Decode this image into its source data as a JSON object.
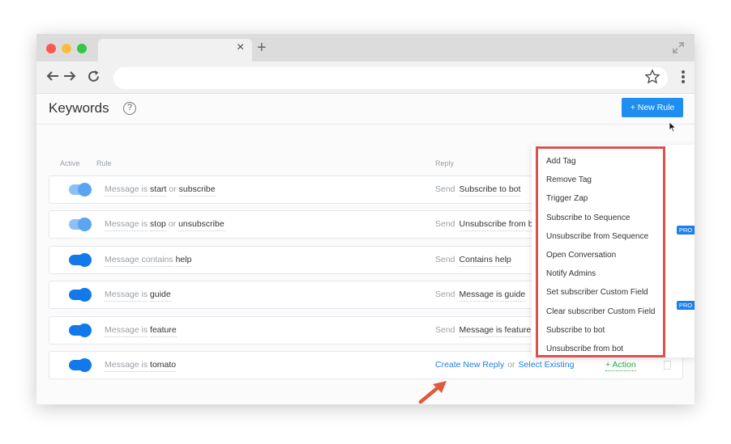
{
  "browser": {
    "tab_close": "×",
    "new_tab": "+"
  },
  "page": {
    "title": "Keywords",
    "help": "?",
    "new_rule_label": "+ New Rule"
  },
  "columns": {
    "active": "Active",
    "rule": "Rule",
    "reply": "Reply"
  },
  "rows": [
    {
      "active": true,
      "toggle_state": "disabled",
      "condition": "Message is",
      "values": [
        "start",
        "subscribe"
      ],
      "separator": "or",
      "send": "Send",
      "reply": "Subscribe to bot"
    },
    {
      "active": true,
      "toggle_state": "disabled",
      "condition": "Message is",
      "values": [
        "stop",
        "unsubscribe"
      ],
      "separator": "or",
      "send": "Send",
      "reply": "Unsubscribe from b"
    },
    {
      "active": true,
      "toggle_state": "on",
      "condition": "Message contains",
      "values": [
        "help"
      ],
      "separator": "",
      "send": "Send",
      "reply": "Contains help"
    },
    {
      "active": true,
      "toggle_state": "on",
      "condition": "Message is",
      "values": [
        "guide"
      ],
      "separator": "",
      "send": "Send",
      "reply": "Message is guide"
    },
    {
      "active": true,
      "toggle_state": "on",
      "condition": "Message is",
      "values": [
        "feature"
      ],
      "separator": "",
      "send": "Send",
      "reply": "Message is feature"
    },
    {
      "active": true,
      "toggle_state": "on",
      "condition": "Message is",
      "values": [
        "tomato"
      ],
      "separator": "",
      "create_reply": "Create New Reply",
      "or": "or",
      "select_existing": "Select Existing",
      "action": "+ Action"
    }
  ],
  "dropdown": {
    "items": [
      "Add Tag",
      "Remove Tag",
      "Trigger Zap",
      "Subscribe to Sequence",
      "Unsubscribe from Sequence",
      "Open Conversation",
      "Notify Admins",
      "Set subscriber Custom Field",
      "Clear subscriber Custom Field",
      "Subscribe to bot",
      "Unsubscribe from bot"
    ],
    "pro_badge": "PRO"
  },
  "colors": {
    "accent": "#1e8ef0",
    "highlight_border": "#d9534f",
    "action_green": "#2ea44f",
    "annotation_arrow": "#e05a3f"
  }
}
